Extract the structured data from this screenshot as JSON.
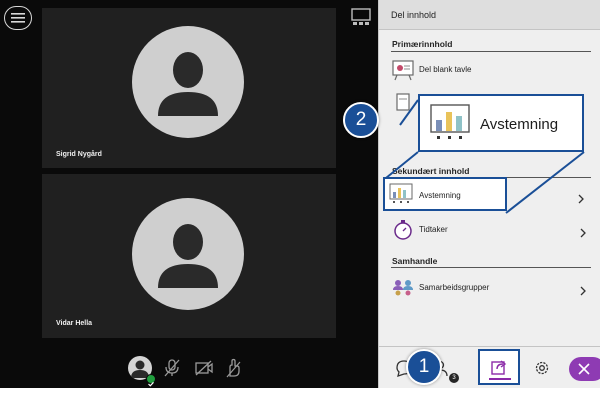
{
  "video": {
    "participants": [
      {
        "name": "Sigrid Nygård"
      },
      {
        "name": "Vidar Hella"
      }
    ]
  },
  "panel": {
    "title": "Del innhold",
    "sections": {
      "primary": {
        "title": "Primærinnhold",
        "items": [
          {
            "label": "Del blank tavle"
          }
        ]
      },
      "secondary": {
        "title": "Sekundært innhold",
        "items": [
          {
            "label": "Avstemning"
          },
          {
            "label": "Tidtaker"
          }
        ]
      },
      "collaborate": {
        "title": "Samhandle",
        "items": [
          {
            "label": "Samarbeidsgrupper"
          }
        ]
      }
    },
    "footer": {
      "chat_badge": "3"
    }
  },
  "callouts": {
    "one": "1",
    "two": "2",
    "zoom_label": "Avstemning"
  },
  "colors": {
    "callout_blue": "#1a4f97",
    "accent_purple": "#8e3bb3",
    "status_green": "#1f9d3d"
  }
}
